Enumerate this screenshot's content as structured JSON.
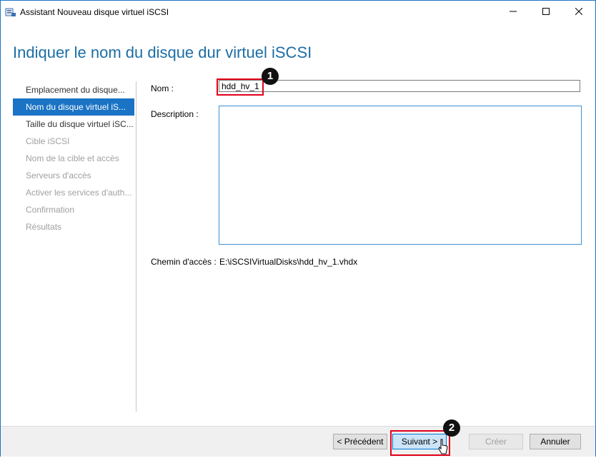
{
  "window": {
    "title": "Assistant Nouveau disque virtuel iSCSI",
    "icon": "server-manager-icon"
  },
  "page": {
    "heading": "Indiquer le nom du disque dur virtuel iSCSI"
  },
  "nav": {
    "items": [
      {
        "label": "Emplacement du disque...",
        "state": "done"
      },
      {
        "label": "Nom du disque virtuel iS...",
        "state": "active"
      },
      {
        "label": "Taille du disque virtuel iSC...",
        "state": "done"
      },
      {
        "label": "Cible iSCSI",
        "state": "disabled"
      },
      {
        "label": "Nom de la cible et accès",
        "state": "disabled"
      },
      {
        "label": "Serveurs d'accès",
        "state": "disabled"
      },
      {
        "label": "Activer les services d'auth...",
        "state": "disabled"
      },
      {
        "label": "Confirmation",
        "state": "disabled"
      },
      {
        "label": "Résultats",
        "state": "disabled"
      }
    ]
  },
  "form": {
    "name_label": "Nom :",
    "name_value": "hdd_hv_1",
    "description_label": "Description :",
    "description_value": "",
    "path_label": "Chemin d'accès :",
    "path_value": "E:\\iSCSIVirtualDisks\\hdd_hv_1.vhdx"
  },
  "annotations": {
    "step1": "1",
    "step2": "2"
  },
  "buttons": {
    "previous": "< Précédent",
    "next": "Suivant >",
    "create": "Créer",
    "cancel": "Annuler"
  },
  "colors": {
    "accent": "#1a73c4",
    "heading": "#1c6ea4",
    "highlight": "#e2001a"
  }
}
